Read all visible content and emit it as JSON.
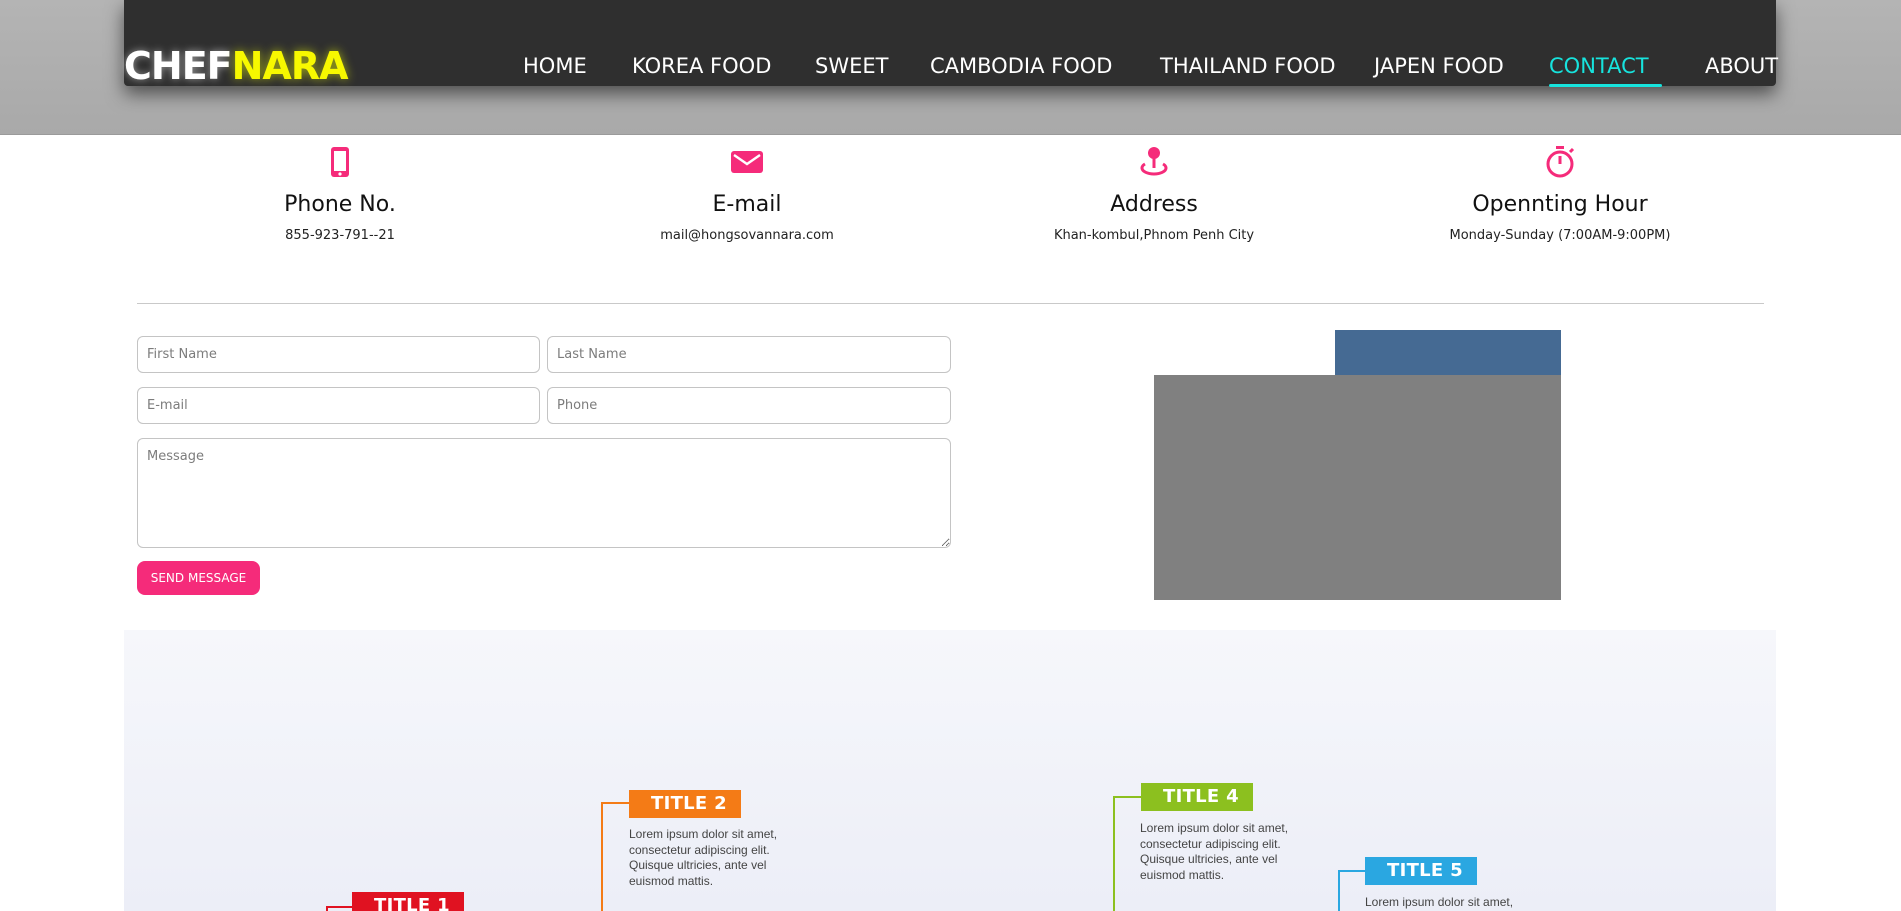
{
  "header": {
    "logo_part1": "CHEF",
    "logo_part2": "NARA",
    "nav": [
      {
        "label": "HOME"
      },
      {
        "label": "KOREA FOOD"
      },
      {
        "label": "SWEET"
      },
      {
        "label": "CAMBODIA FOOD"
      },
      {
        "label": "THAILAND FOOD"
      },
      {
        "label": "JAPEN FOOD"
      },
      {
        "label": "CONTACT",
        "active": true
      },
      {
        "label": "ABOUT"
      }
    ]
  },
  "contact_info": [
    {
      "icon": "phone-icon",
      "title": "Phone No.",
      "value": "855-923-791--21"
    },
    {
      "icon": "mail-icon",
      "title": "E-mail",
      "value": "mail@hongsovannara.com"
    },
    {
      "icon": "location-pin-icon",
      "title": "Address",
      "value": "Khan-kombul,Phnom Penh City"
    },
    {
      "icon": "stopwatch-icon",
      "title": "Opennting Hour",
      "value": "Monday-Sunday (7:00AM-9:00PM)"
    }
  ],
  "form": {
    "first_name_placeholder": "First Name",
    "last_name_placeholder": "Last Name",
    "email_placeholder": "E-mail",
    "phone_placeholder": "Phone",
    "message_placeholder": "Message",
    "send_label": "SEND MESSAGE"
  },
  "timeline": [
    {
      "title": "TITLE 1",
      "color": "#e01221",
      "text": ""
    },
    {
      "title": "TITLE 2",
      "color": "#f47b16",
      "text": "Lorem ipsum dolor sit amet, consectetur adipiscing elit. Quisque ultricies, ante vel euismod mattis."
    },
    {
      "title": "TITLE 4",
      "color": "#8cc01f",
      "text": "Lorem ipsum dolor sit amet, consectetur adipiscing elit. Quisque ultricies, ante vel euismod mattis."
    },
    {
      "title": "TITLE 5",
      "color": "#2aa7e1",
      "text": "Lorem ipsum dolor sit amet,"
    }
  ],
  "colors": {
    "accent_pink": "#f52b7a",
    "accent_cyan": "#17e3dd",
    "logo_yellow": "#f7f800"
  }
}
